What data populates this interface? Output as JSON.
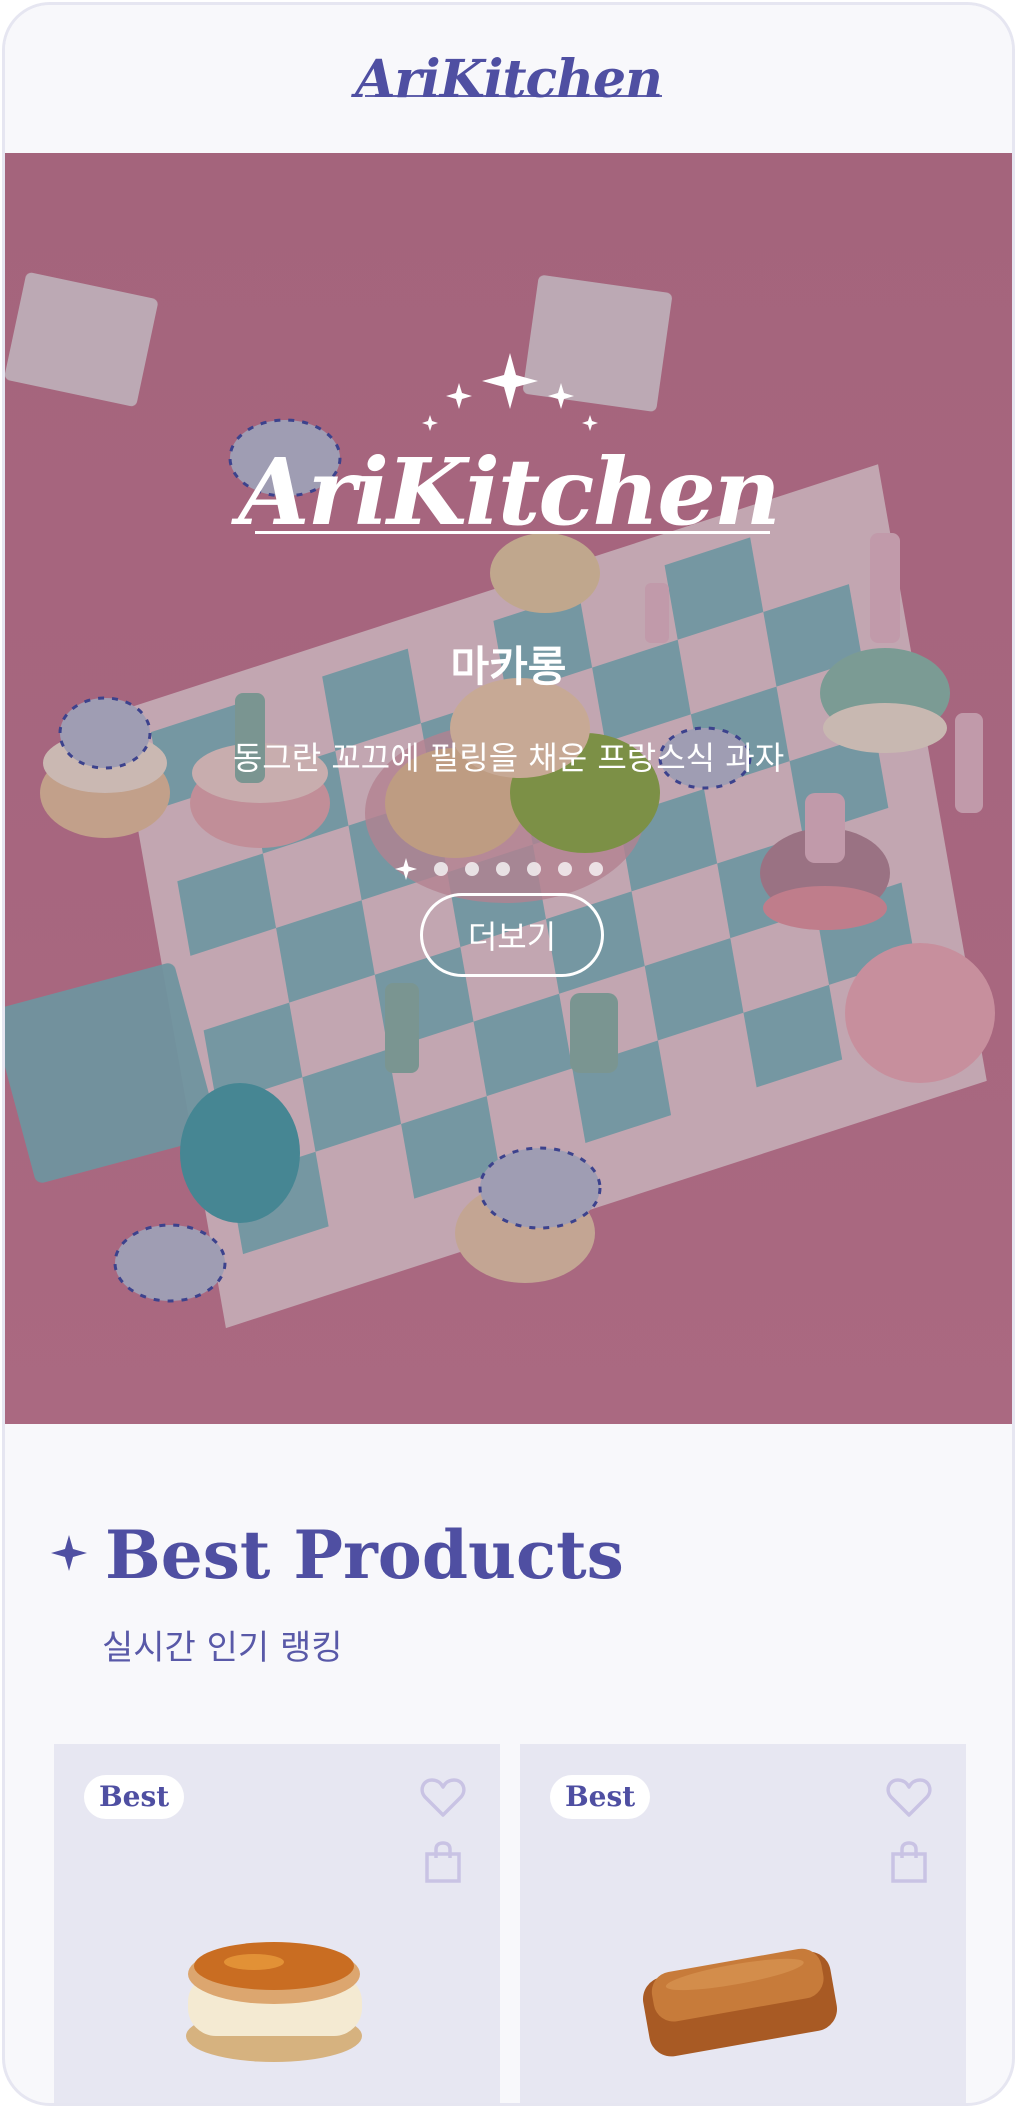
{
  "header": {
    "brand": "AriKitchen"
  },
  "hero": {
    "logo": "AriKitchen",
    "title": "마카롱",
    "subtitle": "동그란 꼬끄에 필링을 채운 프랑스식 과자",
    "more_label": "더보기",
    "slide_count": 7,
    "active_slide": 1
  },
  "best": {
    "title": "Best Products",
    "subtitle": "실시간 인기 랭킹",
    "products": [
      {
        "badge": "Best",
        "icon_like": "heart-icon",
        "icon_cart": "shopping-bag-icon",
        "image": "macaron"
      },
      {
        "badge": "Best",
        "icon_like": "heart-icon",
        "icon_cart": "shopping-bag-icon",
        "image": "financier-loaf"
      }
    ]
  },
  "colors": {
    "brand": "#4f4fa2",
    "background": "#f8f8fb",
    "card": "#e7e7f2",
    "hero_pink": "#c87b92"
  }
}
